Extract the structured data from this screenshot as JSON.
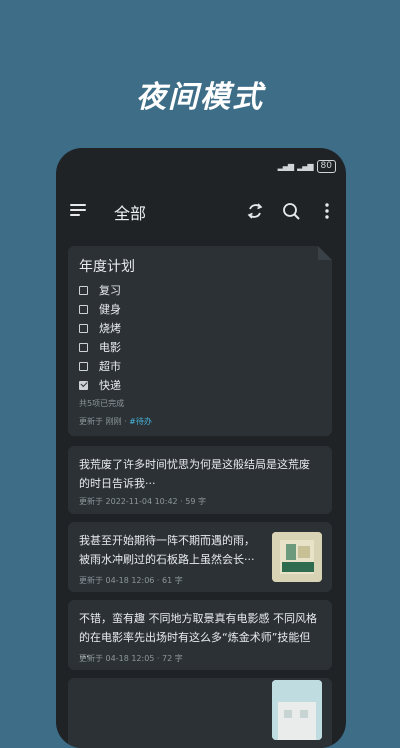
{
  "headline": "夜间模式",
  "status": {
    "battery": "80"
  },
  "appbar": {
    "title": "全部"
  },
  "plan": {
    "title": "年度计划",
    "items": [
      {
        "label": "复习",
        "checked": false
      },
      {
        "label": "健身",
        "checked": false
      },
      {
        "label": "烧烤",
        "checked": false
      },
      {
        "label": "电影",
        "checked": false
      },
      {
        "label": "超市",
        "checked": false
      },
      {
        "label": "快递",
        "checked": true
      }
    ],
    "summary": "共5项已完成",
    "updated": "更新于 刚刚 · ",
    "tag": "#待办"
  },
  "notes": [
    {
      "body": "我荒废了许多时间忧思为何是这般结局是这荒废的时日告诉我···",
      "meta": "更新于 2022-11-04 10:42 · 59 字"
    },
    {
      "body": "我甚至开始期待一阵不期而遇的雨，被雨水冲刷过的石板路上虽然会长···",
      "meta": "更新于 04-18 12:06 · 61 字"
    },
    {
      "body": "不错，蛮有趣 不同地方取景真有电影感 不同风格的在电影率先出场时有这么多“炼金术师”技能但···",
      "meta": "更新于 04-18 12:05 · 72 字"
    }
  ],
  "colors": {
    "background": "#3e6d87",
    "phone": "#1f2326",
    "card": "#2b3135",
    "accent": "#49b6e0"
  }
}
